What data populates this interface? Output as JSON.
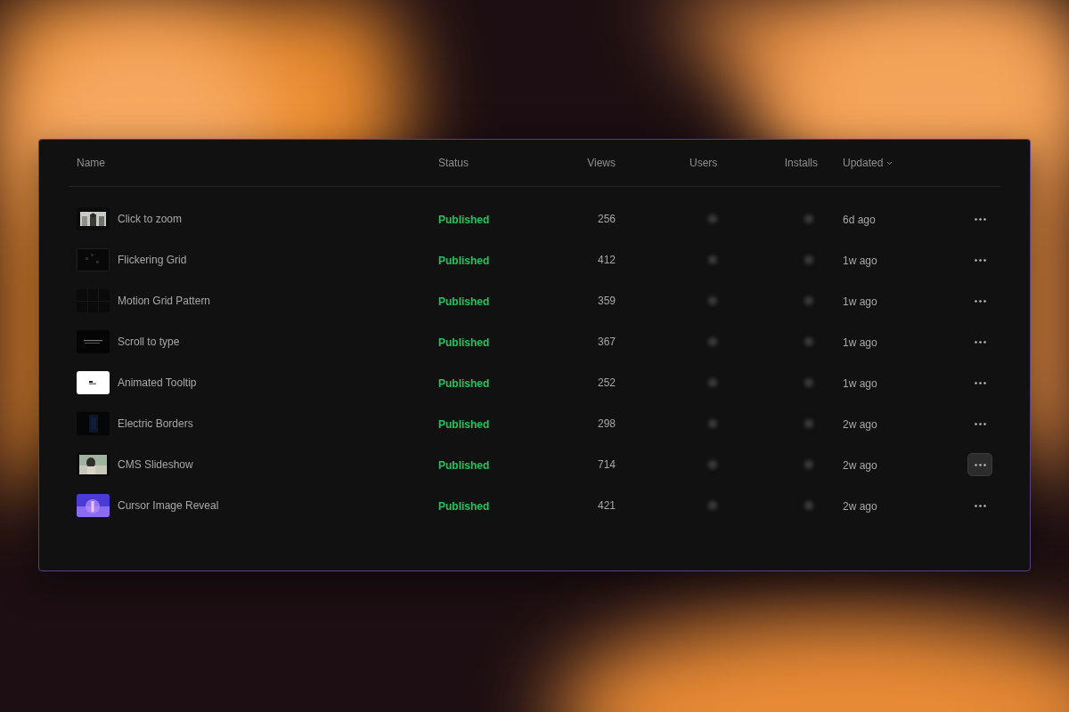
{
  "table": {
    "columns": [
      {
        "label": "Name",
        "sorted": false
      },
      {
        "label": "Status",
        "sorted": false
      },
      {
        "label": "Views",
        "sorted": false
      },
      {
        "label": "Users",
        "sorted": false
      },
      {
        "label": "Installs",
        "sorted": false
      },
      {
        "label": "Updated",
        "sorted": true
      }
    ],
    "rows": [
      {
        "name": "Click to zoom",
        "status": "Published",
        "views": "256",
        "updated": "6d ago",
        "menu_highlighted": false
      },
      {
        "name": "Flickering Grid",
        "status": "Published",
        "views": "412",
        "updated": "1w ago",
        "menu_highlighted": false
      },
      {
        "name": "Motion Grid Pattern",
        "status": "Published",
        "views": "359",
        "updated": "1w ago",
        "menu_highlighted": false
      },
      {
        "name": "Scroll to type",
        "status": "Published",
        "views": "367",
        "updated": "1w ago",
        "menu_highlighted": false
      },
      {
        "name": "Animated Tooltip",
        "status": "Published",
        "views": "252",
        "updated": "1w ago",
        "menu_highlighted": false
      },
      {
        "name": "Electric Borders",
        "status": "Published",
        "views": "298",
        "updated": "2w ago",
        "menu_highlighted": false
      },
      {
        "name": "CMS Slideshow",
        "status": "Published",
        "views": "714",
        "updated": "2w ago",
        "menu_highlighted": true
      },
      {
        "name": "Cursor Image Reveal",
        "status": "Published",
        "views": "421",
        "updated": "2w ago",
        "menu_highlighted": false
      }
    ]
  }
}
